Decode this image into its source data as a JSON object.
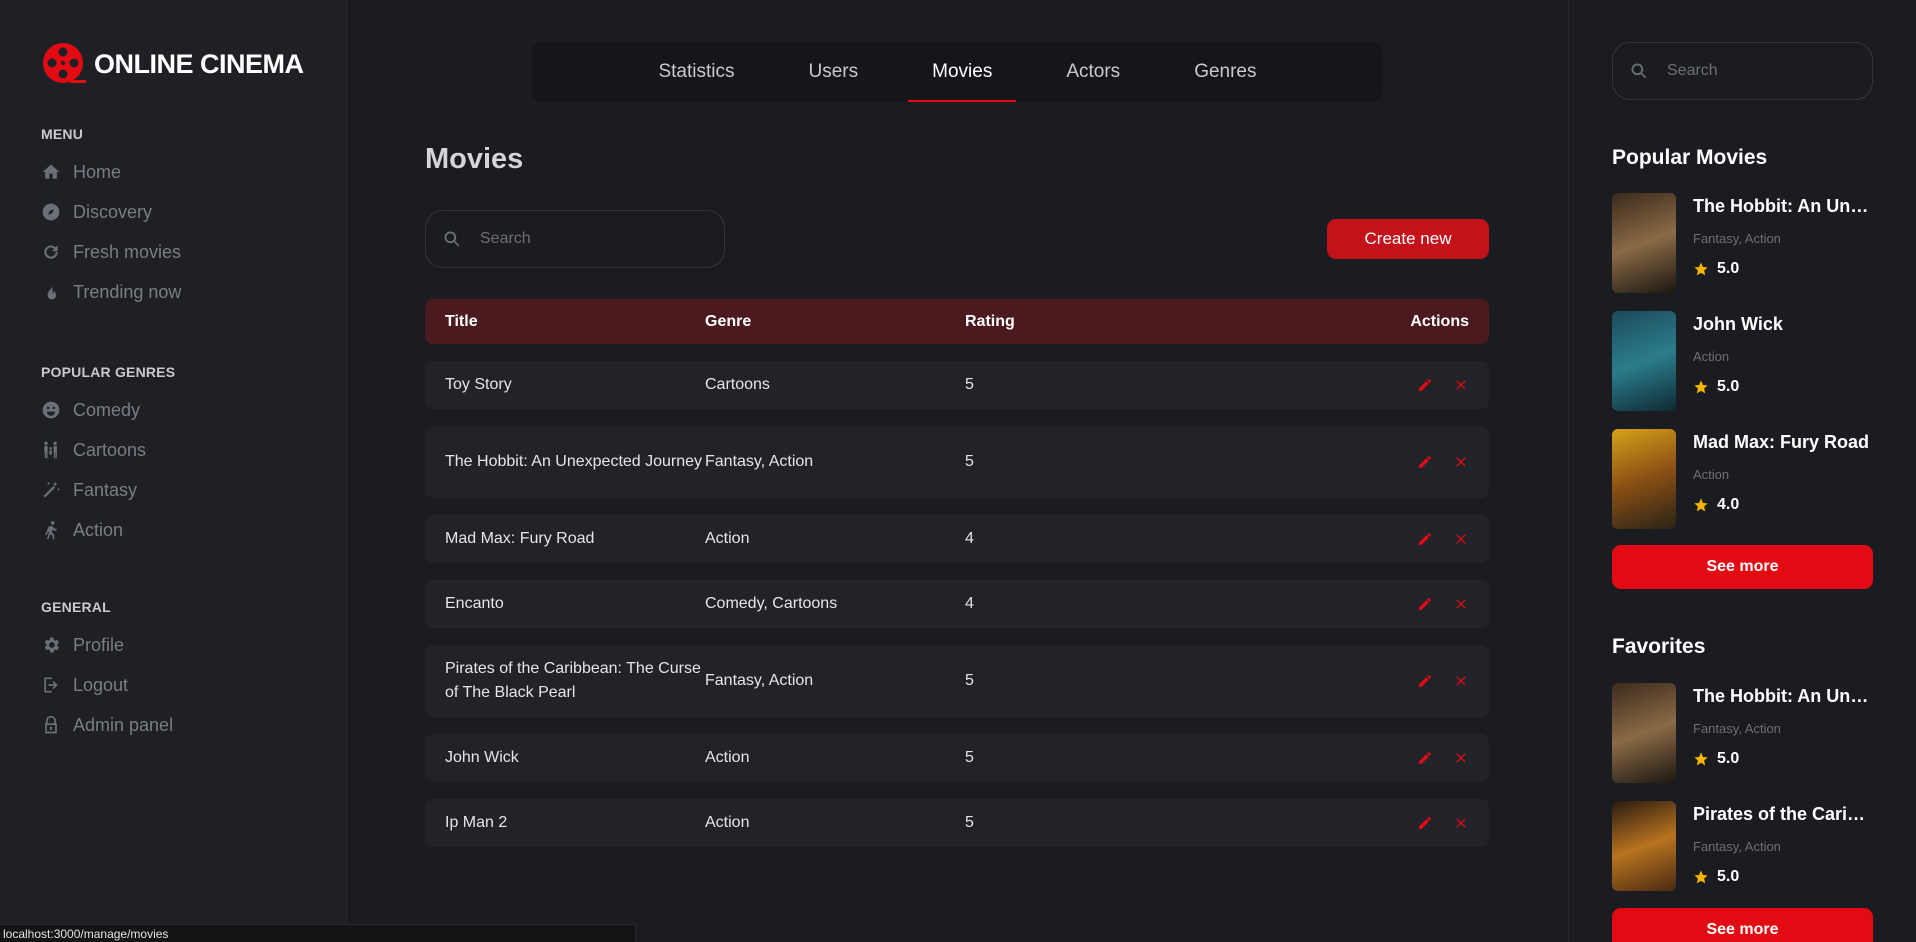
{
  "app": {
    "logo_text": "ONLINE CINEMA",
    "accent_color": "#e30b13"
  },
  "sidebar": {
    "menu": {
      "heading": "Menu",
      "items": [
        {
          "label": "Home",
          "icon": "home-icon"
        },
        {
          "label": "Discovery",
          "icon": "compass-icon"
        },
        {
          "label": "Fresh movies",
          "icon": "refresh-icon"
        },
        {
          "label": "Trending now",
          "icon": "fire-icon"
        }
      ]
    },
    "genres": {
      "heading": "Popular genres",
      "items": [
        {
          "label": "Comedy",
          "icon": "smile-icon"
        },
        {
          "label": "Cartoons",
          "icon": "family-icon"
        },
        {
          "label": "Fantasy",
          "icon": "magic-wand-icon"
        },
        {
          "label": "Action",
          "icon": "running-icon"
        }
      ]
    },
    "general": {
      "heading": "General",
      "items": [
        {
          "label": "Profile",
          "icon": "gear-icon"
        },
        {
          "label": "Logout",
          "icon": "logout-icon"
        },
        {
          "label": "Admin panel",
          "icon": "lock-icon"
        }
      ]
    }
  },
  "tabs": [
    {
      "label": "Statistics",
      "active": false
    },
    {
      "label": "Users",
      "active": false
    },
    {
      "label": "Movies",
      "active": true
    },
    {
      "label": "Actors",
      "active": false
    },
    {
      "label": "Genres",
      "active": false
    }
  ],
  "main": {
    "title": "Movies",
    "search_placeholder": "Search",
    "create_label": "Create new",
    "table": {
      "headers": {
        "title": "Title",
        "genre": "Genre",
        "rating": "Rating",
        "actions": "Actions"
      },
      "rows": [
        {
          "title": "Toy Story",
          "genre": "Cartoons",
          "rating": "5"
        },
        {
          "title": "The Hobbit: An Unexpected Journey",
          "genre": "Fantasy, Action",
          "rating": "5"
        },
        {
          "title": "Mad Max: Fury Road",
          "genre": "Action",
          "rating": "4"
        },
        {
          "title": "Encanto",
          "genre": "Comedy, Cartoons",
          "rating": "4"
        },
        {
          "title": "Pirates of the Caribbean: The Curse of The Black Pearl",
          "genre": "Fantasy, Action",
          "rating": "5"
        },
        {
          "title": "John Wick",
          "genre": "Action",
          "rating": "5"
        },
        {
          "title": "Ip Man 2",
          "genre": "Action",
          "rating": "5"
        }
      ]
    }
  },
  "right": {
    "search_placeholder": "Search",
    "popular": {
      "title": "Popular Movies",
      "movies": [
        {
          "name": "The Hobbit: An Unexpected Journey",
          "genres": "Fantasy, Action",
          "rating": "5.0",
          "poster_colors": [
            "#3b2a1c",
            "#8a6a45",
            "#1c1712"
          ]
        },
        {
          "name": "John Wick",
          "genres": "Action",
          "rating": "5.0",
          "poster_colors": [
            "#1c4a5a",
            "#2b7d8c",
            "#0f2a33"
          ]
        },
        {
          "name": "Mad Max: Fury Road",
          "genres": "Action",
          "rating": "4.0",
          "poster_colors": [
            "#d7a21a",
            "#8a4f14",
            "#2a2317"
          ]
        }
      ],
      "see_more": "See more"
    },
    "favorites": {
      "title": "Favorites",
      "movies": [
        {
          "name": "The Hobbit: An Unexpected Journey",
          "genres": "Fantasy, Action",
          "rating": "5.0",
          "poster_colors": [
            "#3b2a1c",
            "#8a6a45",
            "#1c1712"
          ]
        },
        {
          "name": "Pirates of the Caribbean: The Curse of The Black Pearl",
          "genres": "Fantasy, Action",
          "rating": "5.0",
          "poster_colors": [
            "#2a1a10",
            "#b8731f",
            "#4a2a12"
          ]
        }
      ],
      "see_more": "See more"
    }
  },
  "status_bar": "localhost:3000/manage/movies"
}
